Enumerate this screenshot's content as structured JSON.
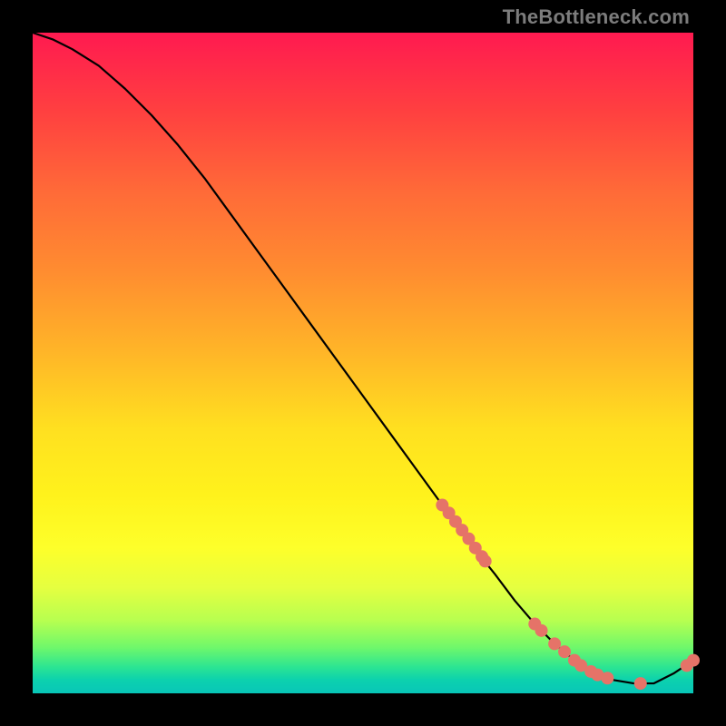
{
  "watermark": "TheBottleneck.com",
  "colors": {
    "background": "#000000",
    "point": "#e57368",
    "line": "#000000"
  },
  "chart_data": {
    "type": "line",
    "title": "",
    "xlabel": "",
    "ylabel": "",
    "xlim": [
      0,
      100
    ],
    "ylim": [
      0,
      100
    ],
    "curve": {
      "x": [
        0,
        3,
        6,
        10,
        14,
        18,
        22,
        26,
        30,
        34,
        38,
        42,
        46,
        50,
        54,
        58,
        62,
        66,
        70,
        73,
        76,
        79,
        82,
        85,
        88,
        91,
        94,
        97,
        100
      ],
      "y": [
        100,
        99,
        97.5,
        95,
        91.5,
        87.5,
        83,
        78,
        72.5,
        67,
        61.5,
        56,
        50.5,
        45,
        39.5,
        34,
        28.5,
        23,
        18,
        14,
        10.5,
        7.5,
        5,
        3,
        2,
        1.5,
        1.5,
        3,
        5
      ]
    },
    "series": [
      {
        "name": "highlighted-points",
        "x": [
          62,
          63,
          64,
          65,
          66,
          67,
          68,
          68.5,
          76,
          77,
          79,
          80.5,
          82,
          83,
          84.5,
          85.5,
          87,
          92,
          99,
          100
        ],
        "y": [
          28.5,
          27.3,
          26,
          24.7,
          23.4,
          22,
          20.7,
          20,
          10.5,
          9.5,
          7.5,
          6.3,
          5,
          4.2,
          3.3,
          2.8,
          2.3,
          1.5,
          4.2,
          5
        ]
      }
    ]
  }
}
